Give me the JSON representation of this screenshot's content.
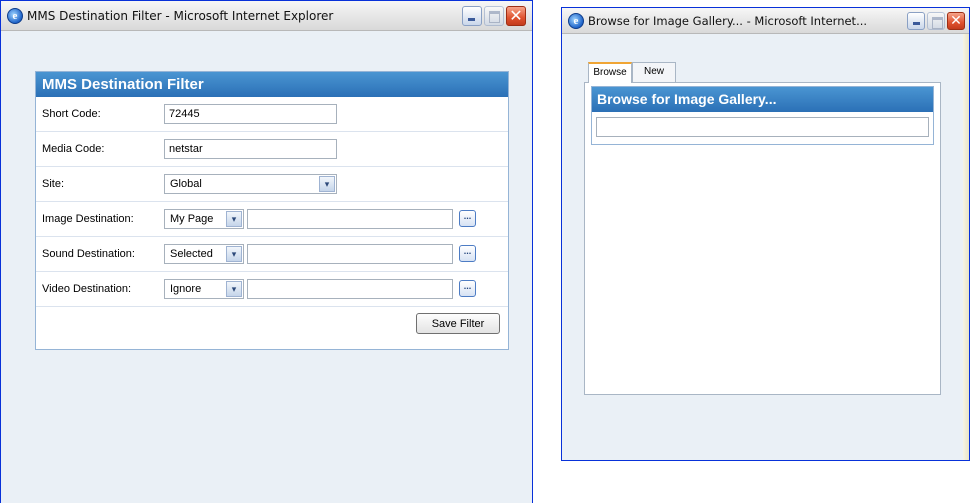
{
  "window1": {
    "title": "MMS Destination Filter - Microsoft Internet Explorer",
    "ie_icon_glyph": "e",
    "panel_title": "MMS Destination Filter",
    "fields": {
      "short_code": {
        "label": "Short Code:",
        "value": "72445"
      },
      "media_code": {
        "label": "Media Code:",
        "value": "netstar"
      },
      "site": {
        "label": "Site:",
        "value": "Global"
      },
      "image_destination": {
        "label": "Image Destination:",
        "value": "My Page",
        "path": ""
      },
      "sound_destination": {
        "label": "Sound Destination:",
        "value": "Selected",
        "path": ""
      },
      "video_destination": {
        "label": "Video Destination:",
        "value": "Ignore",
        "path": ""
      }
    },
    "browse_glyph": "...",
    "dropdown_glyph": "▾",
    "save_label": "Save Filter"
  },
  "window2": {
    "title": "Browse for Image Gallery... - Microsoft Internet...",
    "ie_icon_glyph": "e",
    "tabs": [
      {
        "label": "Browse",
        "active": true
      },
      {
        "label": "New",
        "active": false
      }
    ],
    "panel_title": "Browse for Image Gallery...",
    "gallery_value": ""
  },
  "controls": {
    "close_glyph": "✕"
  },
  "colors": {
    "header_top": "#4a95d2",
    "header_bottom": "#2b70b6",
    "window_bg": "#eaf0f6",
    "tab_accent": "#f0a534",
    "close_red": "#e0522f"
  }
}
